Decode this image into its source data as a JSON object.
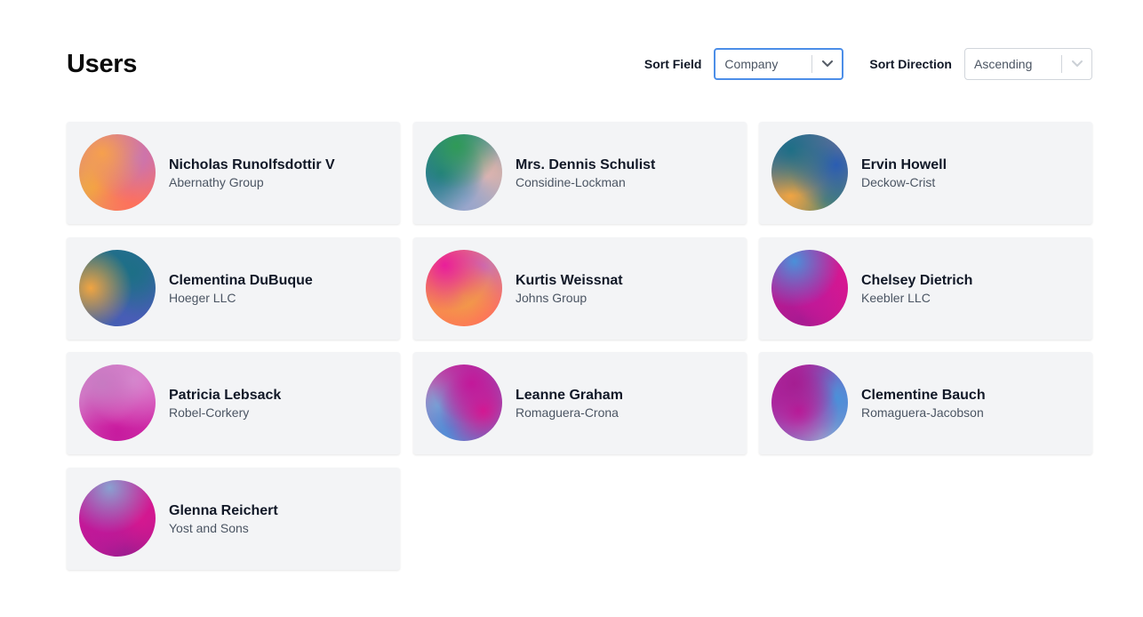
{
  "page": {
    "title": "Users"
  },
  "controls": {
    "sort_field": {
      "label": "Sort Field",
      "value": "Company"
    },
    "sort_direction": {
      "label": "Sort Direction",
      "value": "Ascending"
    }
  },
  "users": [
    {
      "name": "Nicholas Runolfsdottir V",
      "company": "Abernathy Group",
      "avatar_colors": [
        "#f6a04d",
        "#c774b5",
        "#ff6f5b",
        "#f0b03c"
      ]
    },
    {
      "name": "Mrs. Dennis Schulist",
      "company": "Considine-Lockman",
      "avatar_colors": [
        "#2f9a57",
        "#1f7a86",
        "#9aa7d0",
        "#f2b8a6"
      ]
    },
    {
      "name": "Ervin Howell",
      "company": "Deckow-Crist",
      "avatar_colors": [
        "#1e6f86",
        "#2a5db2",
        "#f0a442",
        "#157a7f"
      ]
    },
    {
      "name": "Clementina DuBuque",
      "company": "Hoeger LLC",
      "avatar_colors": [
        "#f0a442",
        "#1d6f86",
        "#4a5cb8",
        "#1a7583"
      ]
    },
    {
      "name": "Kurtis Weissnat",
      "company": "Johns Group",
      "avatar_colors": [
        "#e91e9a",
        "#f0a442",
        "#ff6f5b",
        "#c774b5"
      ]
    },
    {
      "name": "Chelsey Dietrich",
      "company": "Keebler LLC",
      "avatar_colors": [
        "#4a90d9",
        "#c2189a",
        "#d9178f",
        "#9e1b8f"
      ]
    },
    {
      "name": "Patricia Lebsack",
      "company": "Robel-Corkery",
      "avatar_colors": [
        "#c77ac2",
        "#d98ad0",
        "#d42aa8",
        "#c2149a"
      ]
    },
    {
      "name": "Leanne Graham",
      "company": "Romaguera-Crona",
      "avatar_colors": [
        "#c2189a",
        "#d9178f",
        "#4a90d9",
        "#9aa7d0"
      ]
    },
    {
      "name": "Clementine Bauch",
      "company": "Romaguera-Jacobson",
      "avatar_colors": [
        "#a51e92",
        "#c2189a",
        "#4a90d9",
        "#9aa7d0"
      ]
    },
    {
      "name": "Glenna Reichert",
      "company": "Yost and Sons",
      "avatar_colors": [
        "#8aa0d0",
        "#c2189a",
        "#d9178f",
        "#8e1e8f"
      ]
    }
  ]
}
